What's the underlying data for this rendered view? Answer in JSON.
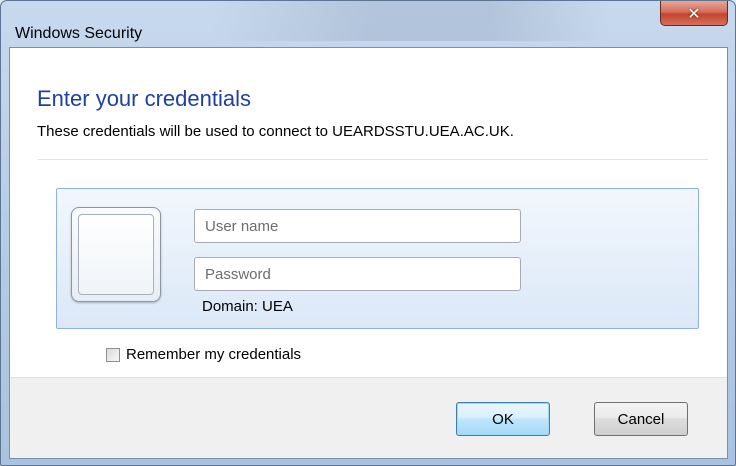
{
  "window": {
    "title": "Windows Security",
    "close_glyph": "✕"
  },
  "dialog": {
    "heading": "Enter your credentials",
    "subtext": "These credentials will be used to connect to UEARDSSTU.UEA.AC.UK.",
    "username_placeholder": "User name",
    "password_placeholder": "Password",
    "domain_text": "Domain: UEA",
    "remember_label": "Remember my credentials",
    "remember_checked": false
  },
  "buttons": {
    "ok_label": "OK",
    "cancel_label": "Cancel"
  },
  "colors": {
    "heading": "#1e3fa5",
    "close_button": "#c2452f",
    "tile_border": "#8fb2dd"
  }
}
